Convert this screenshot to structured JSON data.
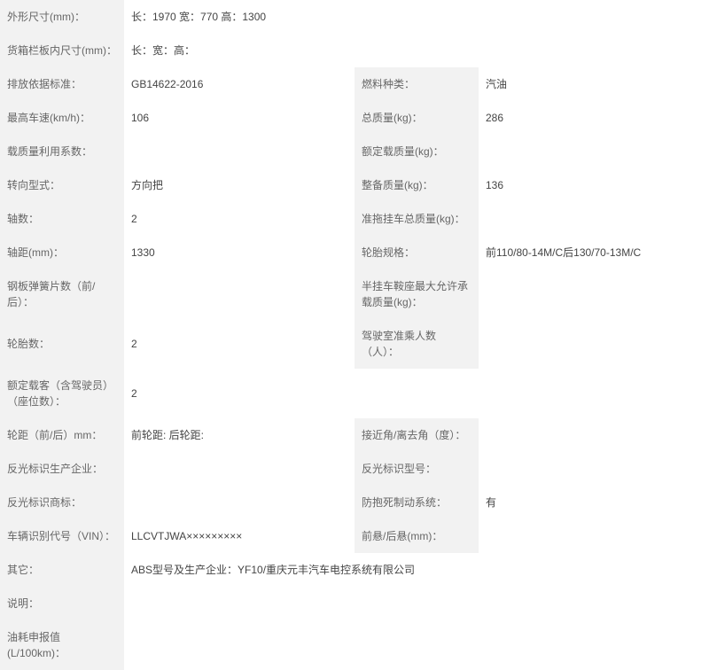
{
  "r": [
    {
      "l1": "外形尺寸(mm)：",
      "v1": "长：1970 宽：770 高：1300",
      "span": 3
    },
    {
      "l1": "货箱栏板内尺寸(mm)：",
      "v1": "长：宽：高：",
      "span": 3
    },
    {
      "l1": "排放依据标准：",
      "v1": "GB14622-2016",
      "l2": "燃料种类：",
      "v2": "汽油"
    },
    {
      "l1": "最高车速(km/h)：",
      "v1": "106",
      "l2": "总质量(kg)：",
      "v2": "286"
    },
    {
      "l1": "载质量利用系数：",
      "v1": "",
      "l2": "额定载质量(kg)：",
      "v2": ""
    },
    {
      "l1": "转向型式：",
      "v1": "方向把",
      "l2": "整备质量(kg)：",
      "v2": "136"
    },
    {
      "l1": "轴数：",
      "v1": "2",
      "l2": "准拖挂车总质量(kg)：",
      "v2": ""
    },
    {
      "l1": "轴距(mm)：",
      "v1": "1330",
      "l2": "轮胎规格：",
      "v2": "前110/80-14M/C后130/70-13M/C"
    },
    {
      "l1": "钢板弹簧片数（前/后）：",
      "v1": "",
      "l2": "半挂车鞍座最大允许承载质量(kg)：",
      "v2": ""
    },
    {
      "l1": "轮胎数：",
      "v1": "2",
      "l2": "驾驶室准乘人数（人）：",
      "v2": ""
    },
    {
      "l1": "额定载客（含驾驶员）（座位数）：",
      "v1": "2",
      "span": 3
    },
    {
      "l1": "轮距（前/后）mm：",
      "v1": "前轮距: 后轮距:",
      "l2": "接近角/离去角（度）：",
      "v2": ""
    },
    {
      "l1": "反光标识生产企业：",
      "v1": "",
      "l2": "反光标识型号：",
      "v2": ""
    },
    {
      "l1": "反光标识商标：",
      "v1": "",
      "l2": "防抱死制动系统：",
      "v2": "有"
    },
    {
      "l1": "车辆识别代号（VIN）：",
      "v1": "LLCVTJWA×××××××××",
      "l2": "前悬/后悬(mm)：",
      "v2": ""
    },
    {
      "l1": "其它：",
      "v1": "ABS型号及生产企业：YF10/重庆元丰汽车电控系统有限公司",
      "span": 3
    },
    {
      "l1": "说明：",
      "v1": "",
      "span": 3
    },
    {
      "l1": "油耗申报值(L/100km)：",
      "v1": "",
      "span": 3
    }
  ]
}
